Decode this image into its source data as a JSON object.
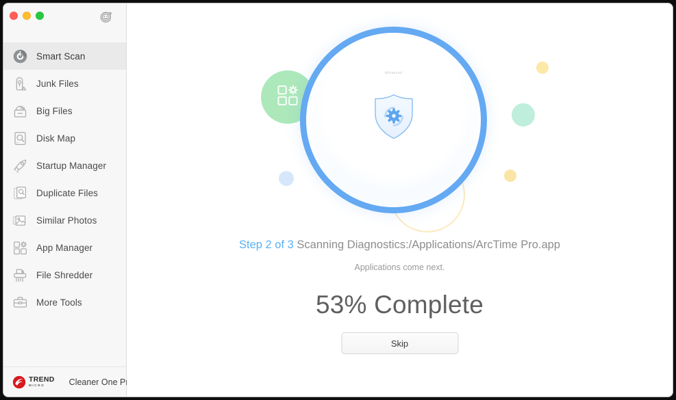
{
  "window": {
    "traffic_lights": [
      {
        "name": "close",
        "color": "#ff5f57"
      },
      {
        "name": "minimize",
        "color": "#ffbd2e"
      },
      {
        "name": "maximize",
        "color": "#28c840"
      }
    ]
  },
  "sidebar": {
    "feedback_icon": "smiley-feedback-icon",
    "items": [
      {
        "label": "Smart Scan",
        "icon": "smart-scan-icon",
        "active": true
      },
      {
        "label": "Junk Files",
        "icon": "junk-files-icon",
        "active": false
      },
      {
        "label": "Big Files",
        "icon": "big-files-icon",
        "active": false
      },
      {
        "label": "Disk Map",
        "icon": "disk-map-icon",
        "active": false
      },
      {
        "label": "Startup Manager",
        "icon": "rocket-icon",
        "active": false
      },
      {
        "label": "Duplicate Files",
        "icon": "duplicate-files-icon",
        "active": false
      },
      {
        "label": "Similar Photos",
        "icon": "similar-photos-icon",
        "active": false
      },
      {
        "label": "App Manager",
        "icon": "app-manager-icon",
        "active": false
      },
      {
        "label": "File Shredder",
        "icon": "file-shredder-icon",
        "active": false
      },
      {
        "label": "More Tools",
        "icon": "toolbox-icon",
        "active": false
      }
    ],
    "footer": {
      "brand_name": "TREND",
      "brand_sub": "MICRO",
      "brand_logo_icon": "trend-micro-logo-icon",
      "product_name": "Cleaner One Pro"
    }
  },
  "main": {
    "scan_ring": {
      "stage_label": "Advanced",
      "shield_icon": "shield-gear-icon",
      "ring_color": "#64a9f2"
    },
    "decorations": [
      {
        "name": "bubble-app-manager",
        "color": "#9ee4ae",
        "icon": "app-manager-icon"
      },
      {
        "name": "bubble-mint",
        "color": "#b4ebd6",
        "icon": ""
      },
      {
        "name": "bubble-yellow-top",
        "color": "#fce9a8",
        "icon": ""
      },
      {
        "name": "bubble-yellow-bottom",
        "color": "#fbe5a6",
        "icon": ""
      },
      {
        "name": "bubble-blue-left",
        "color": "#d7e7fb",
        "icon": ""
      },
      {
        "name": "ghost-ring-disk",
        "color": "#fbe3a8",
        "icon": "disk-icon"
      }
    ],
    "status": {
      "step_label": "Step 2 of 3",
      "step_color": "#57b0f5",
      "detail": "Scanning Diagnostics:/Applications/ArcTime Pro.app",
      "sub_text": "Applications come next."
    },
    "progress": {
      "percent": 53,
      "text": "53% Complete"
    },
    "skip_label": "Skip"
  }
}
